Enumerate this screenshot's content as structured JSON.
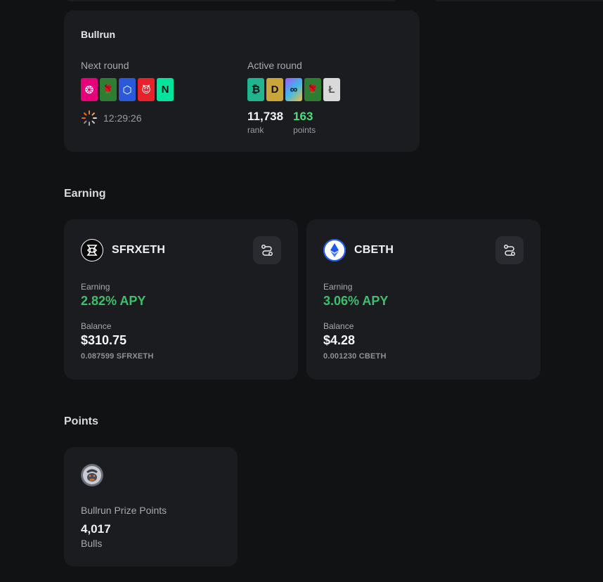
{
  "bullrun": {
    "title": "Bullrun",
    "next_round": {
      "label": "Next round",
      "tokens": [
        {
          "icon": "polkadot-icon",
          "bg": "#e6007a",
          "glyph": "❂",
          "color": "#ffffff"
        },
        {
          "icon": "rose-icon",
          "bg": "#2f7d32",
          "glyph": "🌹",
          "color": "#ffffff"
        },
        {
          "icon": "chainlink-icon",
          "bg": "#2a5ada",
          "glyph": "⬡",
          "color": "#ffffff"
        },
        {
          "icon": "devil-icon",
          "bg": "#e8222a",
          "glyph": "😈",
          "color": "#ffffff"
        },
        {
          "icon": "near-icon",
          "bg": "#00e59b",
          "glyph": "N",
          "color": "#111111"
        }
      ],
      "timer": "12:29:26"
    },
    "active_round": {
      "label": "Active round",
      "tokens": [
        {
          "icon": "bitcoin-icon",
          "bg": "#1fb58f",
          "glyph": "₿",
          "color": "#111111"
        },
        {
          "icon": "dogecoin-icon",
          "bg": "#c9a53a",
          "glyph": "D",
          "color": "#111111"
        },
        {
          "icon": "infinity-icon",
          "bg": "#7b6cf0",
          "glyph": "∞",
          "color": "#111111"
        },
        {
          "icon": "rose-icon",
          "bg": "#2f7d32",
          "glyph": "🌹",
          "color": "#ffffff"
        },
        {
          "icon": "litecoin-icon",
          "bg": "#d9d9d9",
          "glyph": "Ł",
          "color": "#555555"
        }
      ],
      "rank_value": "11,738",
      "rank_label": "rank",
      "points_value": "163",
      "points_label": "points"
    }
  },
  "earning": {
    "title": "Earning",
    "cards": [
      {
        "coin": "SFRXETH",
        "earning_label": "Earning",
        "apy": "2.82% APY",
        "balance_label": "Balance",
        "balance": "$310.75",
        "sub_balance": "0.087599 SFRXETH"
      },
      {
        "coin": "CBETH",
        "earning_label": "Earning",
        "apy": "3.06% APY",
        "balance_label": "Balance",
        "balance": "$4.28",
        "sub_balance": "0.001230 CBETH"
      }
    ]
  },
  "points": {
    "title": "Points",
    "name": "Bullrun Prize Points",
    "value": "4,017",
    "unit": "Bulls"
  },
  "colors": {
    "background": "#111214",
    "card": "#1b1c20",
    "green": "#3fbf6e",
    "bright_green": "#4ade80"
  }
}
